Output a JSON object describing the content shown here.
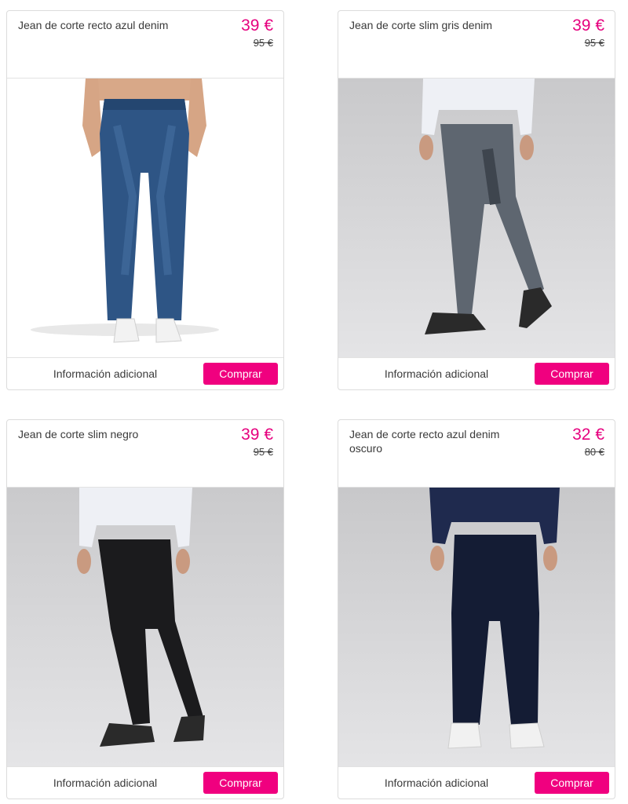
{
  "colors": {
    "accent": "#e6007e",
    "button": "#f0007f",
    "text": "#3a3a3a",
    "border": "#dcdcdc"
  },
  "products": [
    {
      "title": "Jean de corte recto azul denim",
      "price": "39 €",
      "old_price": "95 €",
      "info_label": "Información adicional",
      "buy_label": "Comprar"
    },
    {
      "title": "Jean de corte slim gris denim",
      "price": "39 €",
      "old_price": "95 €",
      "info_label": "Información adicional",
      "buy_label": "Comprar"
    },
    {
      "title": "Jean de corte slim negro",
      "price": "39 €",
      "old_price": "95 €",
      "info_label": "Información adicional",
      "buy_label": "Comprar"
    },
    {
      "title": "Jean de corte recto azul denim oscuro",
      "price": "32 €",
      "old_price": "80 €",
      "info_label": "Información adicional",
      "buy_label": "Comprar"
    }
  ]
}
